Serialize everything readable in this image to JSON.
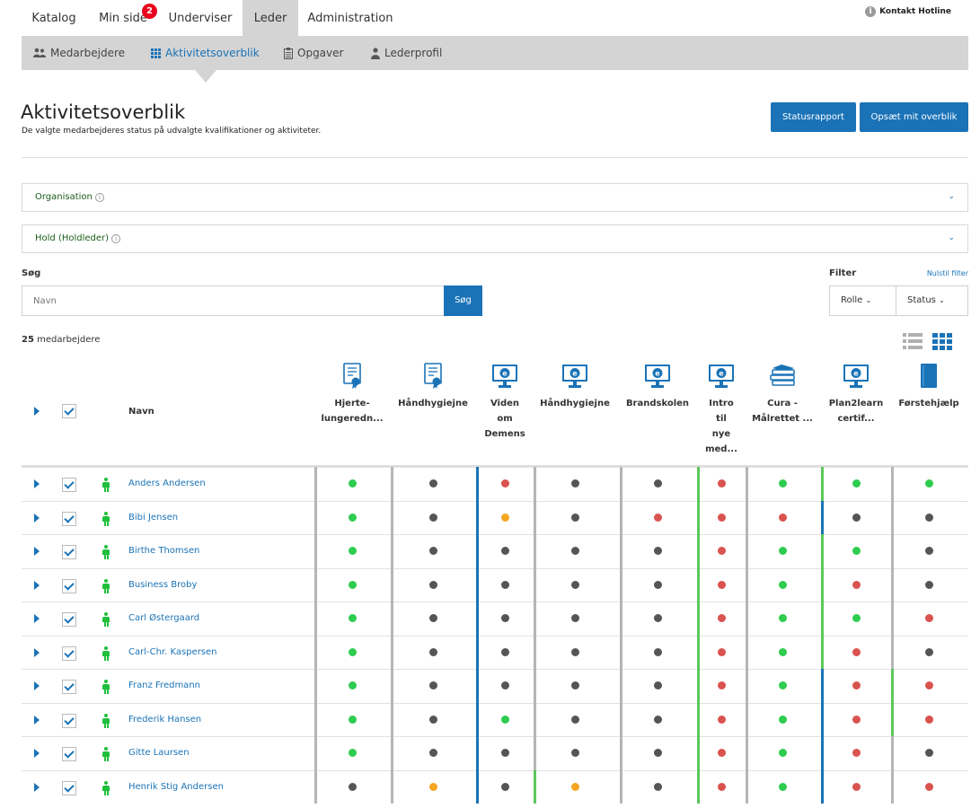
{
  "topnav": {
    "tabs": [
      {
        "label": "Katalog",
        "active": false
      },
      {
        "label": "Min side",
        "active": false,
        "badge": "2"
      },
      {
        "label": "Underviser",
        "active": false
      },
      {
        "label": "Leder",
        "active": true
      },
      {
        "label": "Administration",
        "active": false
      }
    ],
    "hotline": "Kontakt Hotline"
  },
  "subnav": {
    "items": [
      {
        "label": "Medarbejdere",
        "icon": "users-icon",
        "active": false
      },
      {
        "label": "Aktivitetsoverblik",
        "icon": "grid-icon",
        "active": true
      },
      {
        "label": "Opgaver",
        "icon": "clipboard-icon",
        "active": false
      },
      {
        "label": "Lederprofil",
        "icon": "user-icon",
        "active": false
      }
    ]
  },
  "page": {
    "title": "Aktivitetsoverblik",
    "subtitle": "De valgte medarbejderes status på udvalgte kvalifikationer og aktiviteter.",
    "status_button": "Statusrapport",
    "setup_button": "Opsæt mit overblik"
  },
  "accordions": {
    "organisation": "Organisation",
    "hold": "Hold (Holdleder)"
  },
  "search": {
    "label": "Søg",
    "placeholder": "Navn",
    "button": "Søg"
  },
  "filter": {
    "label": "Filter",
    "reset": "Nulstil filter",
    "role": "Rolle",
    "status": "Status"
  },
  "count": {
    "number": "25",
    "suffix": " medarbejdere"
  },
  "table": {
    "name_header": "Navn",
    "columns": [
      {
        "label": "Hjerte-\nlungeredn...",
        "icon": "certificate-icon"
      },
      {
        "label": "Håndhygiejne",
        "icon": "certificate-icon"
      },
      {
        "label": "Viden\nom\nDemens",
        "icon": "elearning-icon"
      },
      {
        "label": "Håndhygiejne",
        "icon": "elearning-icon"
      },
      {
        "label": "Brandskolen",
        "icon": "elearning-icon"
      },
      {
        "label": "Intro\ntil\nnye\nmed...",
        "icon": "elearning-icon"
      },
      {
        "label": "Cura -\nMålrettet ...",
        "icon": "books-icon"
      },
      {
        "label": "Plan2learn\ncertif...",
        "icon": "elearning-icon"
      },
      {
        "label": "Førstehjælp",
        "icon": "book-icon"
      }
    ],
    "rows": [
      {
        "name": "Anders Andersen",
        "status": [
          "green",
          "grey",
          "red",
          "grey",
          "grey",
          "red",
          "green",
          "green",
          "green"
        ],
        "borders": [
          "grey",
          "grey",
          "blue",
          "grey",
          "grey",
          "green",
          "grey",
          "green",
          "grey"
        ]
      },
      {
        "name": "Bibi Jensen",
        "status": [
          "green",
          "grey",
          "orange",
          "grey",
          "red",
          "red",
          "red",
          "grey",
          "grey"
        ],
        "borders": [
          "grey",
          "grey",
          "blue",
          "grey",
          "grey",
          "green",
          "grey",
          "blue",
          "grey"
        ]
      },
      {
        "name": "Birthe Thomsen",
        "status": [
          "green",
          "grey",
          "grey",
          "grey",
          "grey",
          "red",
          "green",
          "green",
          "grey"
        ],
        "borders": [
          "grey",
          "grey",
          "blue",
          "grey",
          "grey",
          "green",
          "grey",
          "green",
          "grey"
        ]
      },
      {
        "name": "Business Broby",
        "status": [
          "green",
          "grey",
          "grey",
          "grey",
          "grey",
          "red",
          "green",
          "red",
          "grey"
        ],
        "borders": [
          "grey",
          "grey",
          "blue",
          "grey",
          "grey",
          "green",
          "grey",
          "green",
          "grey"
        ]
      },
      {
        "name": "Carl Østergaard",
        "status": [
          "green",
          "grey",
          "grey",
          "grey",
          "grey",
          "red",
          "green",
          "green",
          "red"
        ],
        "borders": [
          "grey",
          "grey",
          "blue",
          "grey",
          "grey",
          "green",
          "grey",
          "green",
          "grey"
        ]
      },
      {
        "name": "Carl-Chr. Kaspersen",
        "status": [
          "green",
          "grey",
          "grey",
          "grey",
          "grey",
          "red",
          "green",
          "red",
          "grey"
        ],
        "borders": [
          "grey",
          "grey",
          "blue",
          "grey",
          "grey",
          "green",
          "grey",
          "green",
          "grey"
        ]
      },
      {
        "name": "Franz Fredmann",
        "status": [
          "green",
          "grey",
          "grey",
          "grey",
          "grey",
          "red",
          "green",
          "red",
          "red"
        ],
        "borders": [
          "grey",
          "grey",
          "blue",
          "grey",
          "grey",
          "green",
          "grey",
          "blue",
          "green"
        ]
      },
      {
        "name": "Frederik Hansen",
        "status": [
          "green",
          "grey",
          "green",
          "grey",
          "grey",
          "red",
          "green",
          "red",
          "red"
        ],
        "borders": [
          "grey",
          "grey",
          "blue",
          "grey",
          "grey",
          "green",
          "grey",
          "blue",
          "green"
        ]
      },
      {
        "name": "Gitte Laursen",
        "status": [
          "green",
          "grey",
          "grey",
          "grey",
          "grey",
          "red",
          "green",
          "red",
          "grey"
        ],
        "borders": [
          "grey",
          "grey",
          "blue",
          "grey",
          "grey",
          "green",
          "grey",
          "blue",
          "grey"
        ]
      },
      {
        "name": "Henrik Stig Andersen",
        "status": [
          "grey",
          "orange",
          "grey",
          "orange",
          "grey",
          "red",
          "green",
          "red",
          "red"
        ],
        "borders": [
          "grey",
          "grey",
          "blue",
          "green",
          "grey",
          "green",
          "grey",
          "blue",
          "grey"
        ]
      }
    ]
  },
  "colors": {
    "accent": "#1a73b7",
    "green": "#2ecc4f",
    "grey": "#555555",
    "red": "#d9534f",
    "orange": "#f5a623",
    "border_grey": "#b5b5b5",
    "border_blue": "#1a73b7",
    "border_green": "#5cc85c"
  }
}
